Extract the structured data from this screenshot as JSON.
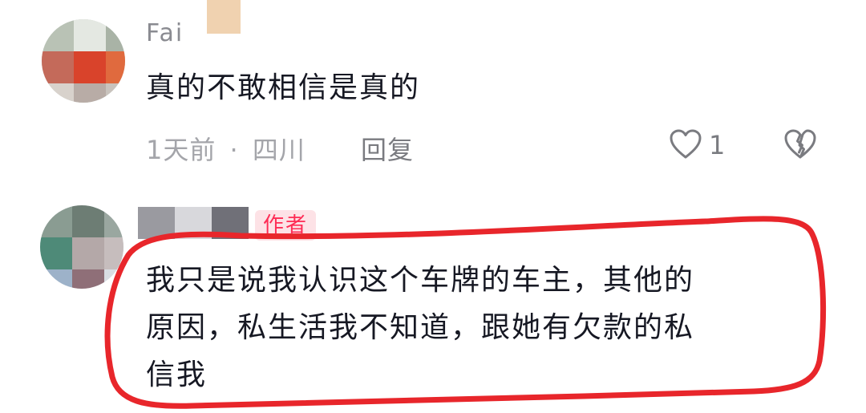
{
  "comments": [
    {
      "username": "Fai",
      "text": "真的不敢相信是真的",
      "time": "1天前",
      "separator": "·",
      "location": "四川",
      "reply_label": "回复",
      "like_count": "1"
    },
    {
      "username": "",
      "author_badge": "作者",
      "text_lines": [
        "我只是说我认识这个车牌的车主，其他的",
        "原因，私生活我不知道，跟她有欠款的私",
        "信我"
      ]
    }
  ],
  "colors": {
    "annotation": "#e8262b",
    "badge_text": "#fe2c55",
    "badge_bg": "#fde2e6"
  },
  "icons": [
    "heart-outline-icon",
    "broken-heart-icon"
  ]
}
